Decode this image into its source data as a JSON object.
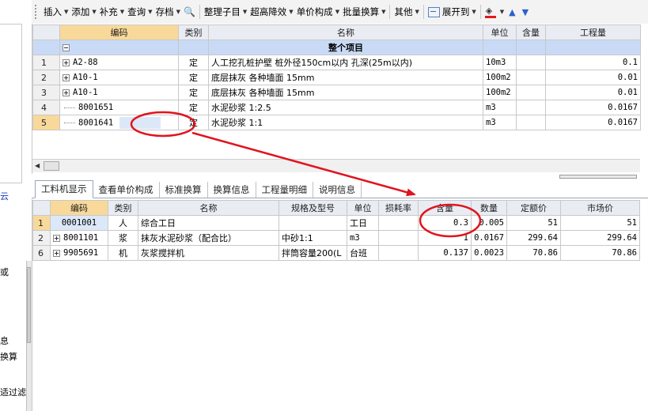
{
  "left_panel": {
    "frag1": "云",
    "frag2": "或",
    "frag3": "息",
    "frag4": "换算",
    "frag5": "适过滤"
  },
  "toolbar": {
    "insert": "插入",
    "add": "添加",
    "supplement": "补充",
    "query": "查询",
    "archive": "存档",
    "organize": "整理子目",
    "height_reduction": "超高降效",
    "unit_price": "单价构成",
    "batch_convert": "批量换算",
    "other": "其他",
    "expand_to": "展开到"
  },
  "upper_grid": {
    "columns": [
      "编码",
      "类别",
      "名称",
      "单位",
      "含量",
      "工程量"
    ],
    "project_row": {
      "name": "整个项目"
    },
    "rows": [
      {
        "no": "1",
        "code": "A2-88",
        "type": "定",
        "name": "人工挖孔桩护壁 桩外径150cm以内 孔深(25m以内)",
        "unit": "10m3",
        "content": "",
        "qty": "0.1",
        "node": "plus"
      },
      {
        "no": "2",
        "code": "A10-1",
        "type": "定",
        "name": "底层抹灰 各种墙面 15mm",
        "unit": "100m2",
        "content": "",
        "qty": "0.01",
        "node": "plus"
      },
      {
        "no": "3",
        "code": "A10-1",
        "type": "定",
        "name": "底层抹灰 各种墙面 15mm",
        "unit": "100m2",
        "content": "",
        "qty": "0.01",
        "node": "plus"
      },
      {
        "no": "4",
        "code": "8001651",
        "type": "定",
        "name": "水泥砂浆 1:2.5",
        "unit": "m3",
        "content": "",
        "qty": "0.0167",
        "node": "line"
      },
      {
        "no": "5",
        "code": "8001641",
        "type": "定",
        "name": "水泥砂浆 1:1",
        "unit": "m3",
        "content": "",
        "qty": "0.0167",
        "node": "line"
      }
    ]
  },
  "tabs": [
    "工料机显示",
    "查看单价构成",
    "标准换算",
    "换算信息",
    "工程量明细",
    "说明信息"
  ],
  "lower_grid": {
    "columns": [
      "编码",
      "类别",
      "名称",
      "规格及型号",
      "单位",
      "损耗率",
      "含量",
      "数量",
      "定额价",
      "市场价"
    ],
    "rows": [
      {
        "no": "1",
        "code": "0001001",
        "type": "人",
        "name": "综合工日",
        "spec": "",
        "unit": "工日",
        "loss": "",
        "content": "0.3",
        "qty": "0.005",
        "price": "51",
        "market": "51",
        "node": "none"
      },
      {
        "no": "2",
        "code": "8001101",
        "type": "浆",
        "name": "抹灰水泥砂浆（配合比）",
        "spec": "中砂1:1",
        "unit": "m3",
        "loss": "",
        "content": "1",
        "qty": "0.0167",
        "price": "299.64",
        "market": "299.64",
        "node": "plus"
      },
      {
        "no": "6",
        "code": "9905691",
        "type": "机",
        "name": "灰浆搅拌机",
        "spec": "拌筒容量200(L",
        "unit": "台班",
        "loss": "",
        "content": "0.137",
        "qty": "0.0023",
        "price": "70.86",
        "market": "70.86",
        "node": "plus"
      }
    ]
  },
  "colors": {
    "annotation_red": "#e0141e",
    "selected_header": "#f8d99a",
    "project_row": "#c9daf6"
  }
}
